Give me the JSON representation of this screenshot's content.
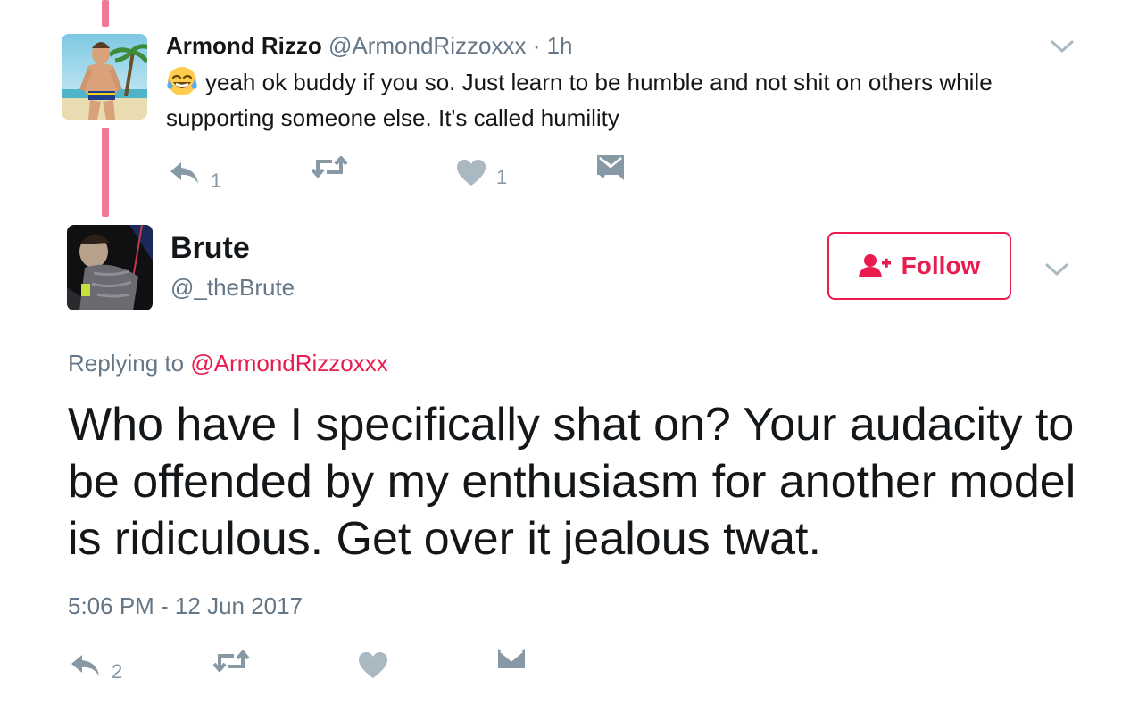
{
  "reply_tweet": {
    "author_name": "Armond Rizzo",
    "author_handle": "@ArmondRizzoxxx",
    "separator": "·",
    "time": "1h",
    "emoji": "face-with-tears-of-joy",
    "text": "yeah ok buddy if you so. Just learn to be humble and not shit on others while supporting someone else. It's called humility",
    "reply_count": "1",
    "retweet_count": "",
    "like_count": "1"
  },
  "main_tweet": {
    "author_name": "Brute",
    "author_handle": "@_theBrute",
    "follow_label": "Follow",
    "replying_prefix": "Replying to",
    "replying_to": "@ArmondRizzoxxx",
    "text": "Who have I specifically shat on? Your audacity to be offended by my enthusiasm for another model is ridiculous. Get over it jealous twat.",
    "timestamp": "5:06 PM - 12 Jun 2017",
    "reply_count": "2",
    "retweet_count": "",
    "like_count": ""
  },
  "icons": {
    "reply": "reply-icon",
    "retweet": "retweet-icon",
    "like": "heart-icon",
    "message": "envelope-icon",
    "more": "chevron-down-icon",
    "follow": "add-user-icon"
  },
  "colors": {
    "accent": "#e81c4f",
    "text": "#14171a",
    "secondary_text": "#657786",
    "action_gray": "#8899a6",
    "thread_line": "#f07ba0"
  }
}
